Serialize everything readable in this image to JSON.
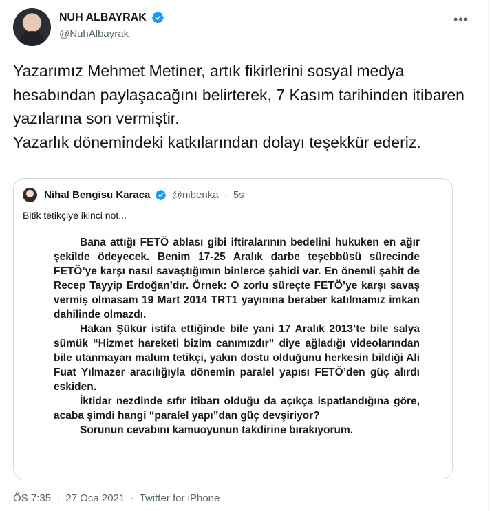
{
  "colors": {
    "verified": "#1d9bf0",
    "text": "#0f1419",
    "muted": "#536471",
    "border": "#cfd9de"
  },
  "author": {
    "name": "NUH ALBAYRAK",
    "handle": "@NuhAlbayrak",
    "verified_icon": "verified-badge-icon"
  },
  "more_icon": "•••",
  "tweet": {
    "lines": [
      "Yazarımız Mehmet Metiner, artık fikirlerini sosyal medya hesabından paylaşacağını belirterek, 7 Kasım tarihinden itibaren yazılarına son vermiştir.",
      "Yazarlık dönemindeki katkılarından dolayı teşekkür ederiz."
    ]
  },
  "quote": {
    "name": "Nihal Bengisu Karaca",
    "handle": "@nibenka",
    "separator": "·",
    "time": "5s",
    "text": "Bitik tetikçiye ikinci not...",
    "document_paragraphs": [
      "Bana attığı FETÖ ablası gibi iftiralarının bedelini hukuken en ağır şekilde ödeyecek. Benim 17-25 Aralık darbe teşebbüsü sürecinde FETÖ’ye karşı nasıl savaştığımın binlerce şahidi var. En önemli şahit de Recep Tayyip Erdoğan’dır. Örnek: O zorlu süreçte FETÖ’ye karşı savaş vermiş olmasam 19 Mart 2014 TRT1 yayınına beraber katılmamız imkan dahilinde olmazdı.",
      "Hakan Şükür istifa ettiğinde bile yani 17 Aralık 2013’te bile salya sümük “Hizmet hareketi bizim canımızdır” diye ağladığı videolarından bile utanmayan malum tetikçi, yakın dostu olduğunu herkesin bildiği Ali Fuat Yılmazer aracılığıyla dönemin paralel yapısı FETÖ’den güç alırdı eskiden.",
      "İktidar nezdinde sıfır itibarı olduğu da açıkça ispatlandığına göre, acaba şimdi hangi “paralel yapı”dan güç devşiriyor?",
      "Sorunun cevabını kamuoyunun takdirine bırakıyorum."
    ]
  },
  "meta": {
    "time": "ÖS 7:35",
    "separator": "·",
    "date": "27 Oca 2021",
    "source": "Twitter for iPhone"
  }
}
